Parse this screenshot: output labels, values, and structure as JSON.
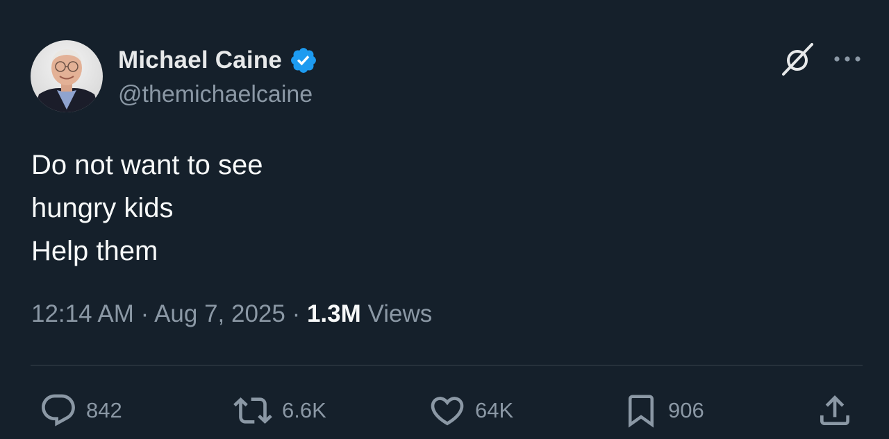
{
  "author": {
    "display_name": "Michael Caine",
    "handle": "@themichaelcaine",
    "verified": true,
    "verified_color": "#1d9bf0"
  },
  "tweet": {
    "lines": [
      "Do not want to see",
      "hungry kids",
      "Help them"
    ]
  },
  "meta": {
    "time": "12:14 AM",
    "separator": " · ",
    "date": "Aug 7, 2025",
    "views_count": "1.3M",
    "views_label": "Views"
  },
  "actions": {
    "replies": "842",
    "reposts": "6.6K",
    "likes": "64K",
    "bookmarks": "906"
  },
  "icons": {
    "header": [
      "grok-icon",
      "more-icon"
    ],
    "actions": [
      "reply-icon",
      "repost-icon",
      "like-icon",
      "bookmark-icon",
      "share-icon"
    ]
  },
  "colors": {
    "background": "#15202b",
    "primary_text": "#e7e9ea",
    "secondary_text": "#8b98a5",
    "divider": "#38444d",
    "accent": "#1d9bf0"
  }
}
